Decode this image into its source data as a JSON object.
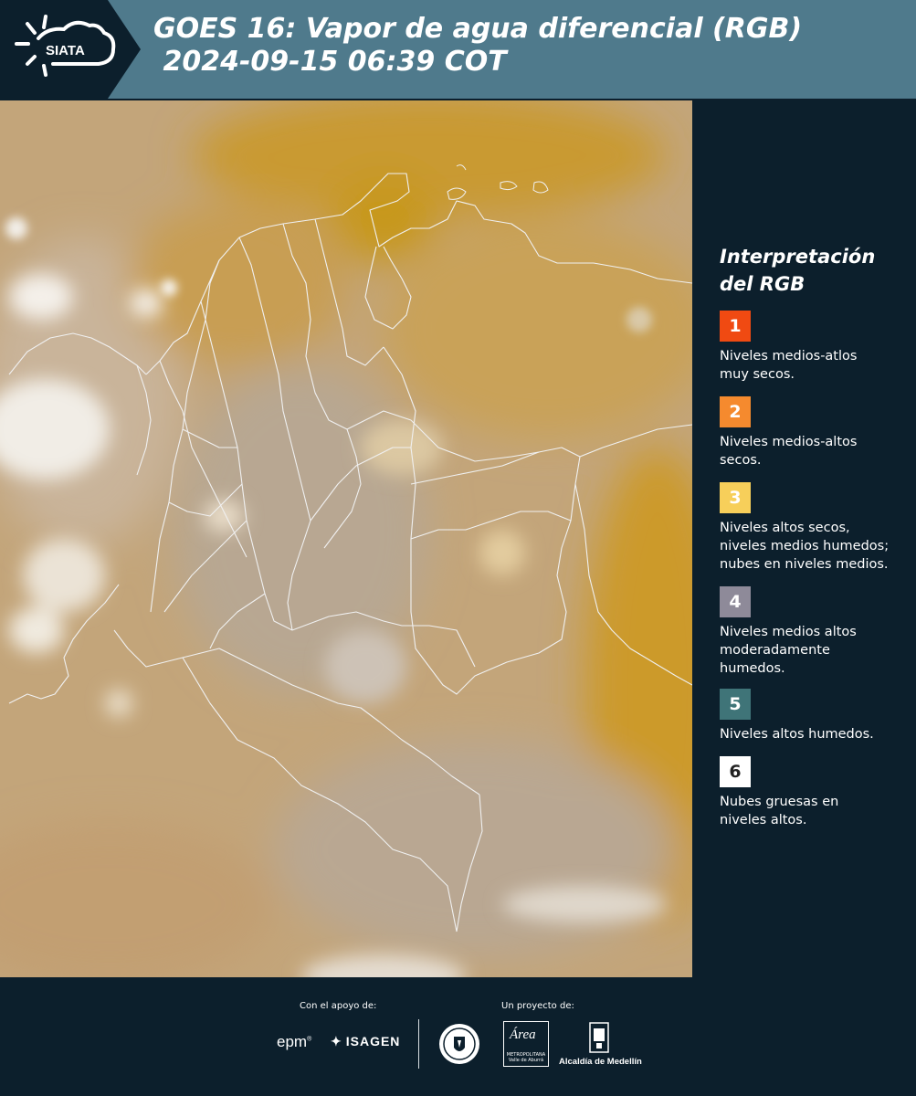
{
  "header": {
    "logo_text": "SIATA",
    "title_line1": "GOES 16: Vapor de agua diferencial (RGB)",
    "title_line2": " 2024-09-15 06:39 COT"
  },
  "legend": {
    "title_line1": "Interpretación",
    "title_line2": "del RGB",
    "items": [
      {
        "number": "1",
        "color": "#f04a12",
        "text_line1": "Niveles medios-atlos",
        "text_line2": "muy secos.",
        "text_line3": ""
      },
      {
        "number": "2",
        "color": "#f58a2e",
        "text_line1": "Niveles medios-altos",
        "text_line2": "secos.",
        "text_line3": ""
      },
      {
        "number": "3",
        "color": "#f7cf5a",
        "text_line1": "Niveles altos secos,",
        "text_line2": "niveles medios humedos;",
        "text_line3": "nubes en niveles medios."
      },
      {
        "number": "4",
        "color": "#8e8a99",
        "text_line1": "Niveles medios altos",
        "text_line2": "moderadamente",
        "text_line3": "humedos."
      },
      {
        "number": "5",
        "color": "#3f7478",
        "text_line1": "Niveles altos humedos.",
        "text_line2": "",
        "text_line3": ""
      },
      {
        "number": "6",
        "color": "#ffffff",
        "text_line1": "Nubes gruesas en",
        "text_line2": "niveles altos.",
        "text_line3": ""
      }
    ]
  },
  "footer": {
    "support_label": "Con el apoyo de:",
    "project_label": "Un proyecto de:",
    "sponsor1": "epm",
    "sponsor2": "ISAGEN",
    "amva_logo_text": "Área",
    "amva_sub1": "METROPOLITANA",
    "amva_sub2": "Valle de Aburrá",
    "alcaldia": "Alcaldía de Medellín"
  }
}
